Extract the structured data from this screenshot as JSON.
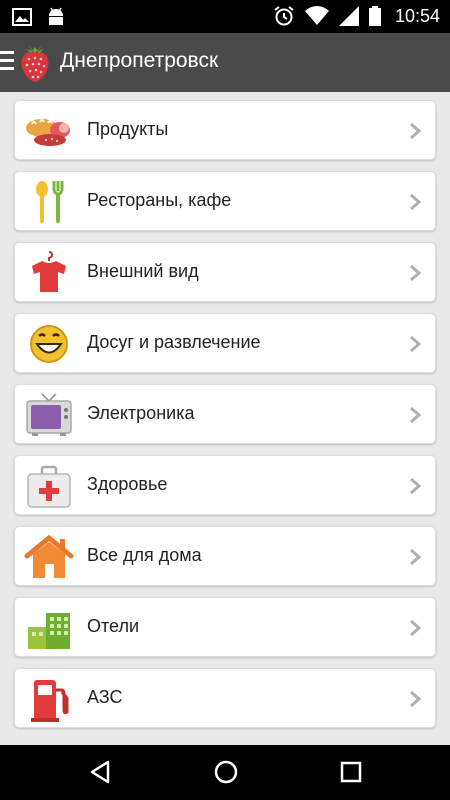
{
  "status_bar": {
    "time": "10:54",
    "icons": [
      "image-icon",
      "android-icon",
      "alarm-icon",
      "wifi-icon",
      "signal-icon",
      "battery-icon"
    ]
  },
  "action_bar": {
    "title": "Днепропетровск",
    "icons": [
      "menu-icon",
      "strawberry-logo-icon"
    ]
  },
  "categories": [
    {
      "label": "Продукты",
      "icon": "bread-sausage-icon"
    },
    {
      "label": "Рестораны, кафе",
      "icon": "cutlery-icon"
    },
    {
      "label": "Внешний вид",
      "icon": "tshirt-hanger-icon"
    },
    {
      "label": "Досуг и развлечение",
      "icon": "smiley-icon"
    },
    {
      "label": "Электроника",
      "icon": "tv-icon"
    },
    {
      "label": "Здоровье",
      "icon": "first-aid-kit-icon"
    },
    {
      "label": "Все для дома",
      "icon": "house-icon"
    },
    {
      "label": "Отели",
      "icon": "hotel-buildings-icon"
    },
    {
      "label": "АЗС",
      "icon": "fuel-pump-icon"
    }
  ],
  "nav_bar": {
    "buttons": [
      "back-button",
      "home-button",
      "recents-button"
    ]
  },
  "colors": {
    "action_bar": "#4a4a4a",
    "background": "#e9e9e9",
    "card": "#ffffff",
    "chevron": "#b0b0b0"
  }
}
